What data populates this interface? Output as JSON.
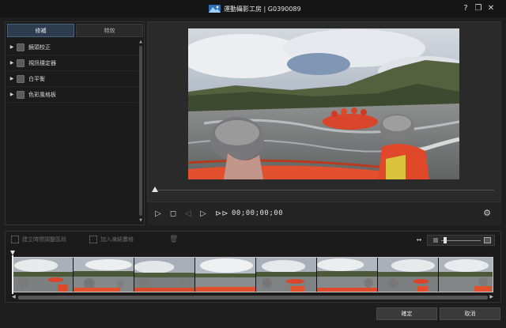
{
  "window": {
    "title": "運動攝影工房 | G0390089",
    "controls": {
      "help": "?",
      "restore": "❐",
      "close": "✕"
    }
  },
  "left_panel": {
    "tabs": [
      {
        "label": "修補",
        "active": true
      },
      {
        "label": "特效",
        "active": false
      }
    ],
    "tools": [
      {
        "label": "鏡頭校正",
        "checked": false
      },
      {
        "label": "視訊穩定器",
        "checked": false
      },
      {
        "label": "白平衡",
        "checked": false
      },
      {
        "label": "色彩風格板",
        "checked": false
      }
    ]
  },
  "player": {
    "timecode": "00;00;00;00",
    "icons": [
      "play-icon",
      "stop-icon",
      "prev-frame-icon",
      "next-frame-icon",
      "fast-forward-icon",
      "settings-icon"
    ]
  },
  "timeline": {
    "buttons": [
      {
        "label": "建立時間調整區段",
        "enabled": false
      },
      {
        "label": "加入凍結畫格",
        "enabled": false
      }
    ],
    "frames": 8
  },
  "footer": {
    "ok_label": "確定",
    "cancel_label": "取消"
  },
  "colors": {
    "accent_tab": "#2d3c4e",
    "background": "#1e1e1f",
    "panel": "#2a2a2b"
  }
}
